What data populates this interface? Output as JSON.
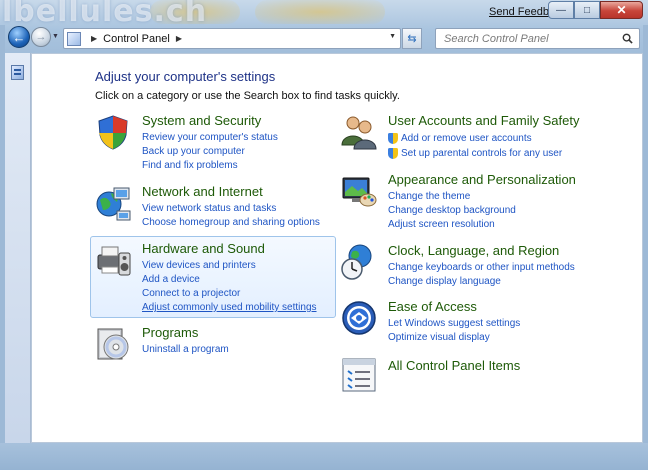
{
  "window": {
    "title_watermark": "lbellules.ch",
    "send_feedback": "Send Feedback"
  },
  "nav": {
    "address_text": "Control Panel",
    "search_placeholder": "Search Control Panel"
  },
  "main": {
    "heading": "Adjust your computer's settings",
    "subheading": "Click on a category or use the Search box to find tasks quickly."
  },
  "categories": [
    {
      "title": "System and Security",
      "icon": "shield-icon",
      "links": [
        "Review your computer's status",
        "Back up your computer",
        "Find and fix problems"
      ]
    },
    {
      "title": "Network and Internet",
      "icon": "network-globe-icon",
      "links": [
        "View network status and tasks",
        "Choose homegroup and sharing options"
      ]
    },
    {
      "title": "Hardware and Sound",
      "icon": "printer-speaker-icon",
      "links": [
        "View devices and printers",
        "Add a device",
        "Connect to a projector",
        "Adjust commonly used mobility settings"
      ]
    },
    {
      "title": "Programs",
      "icon": "programs-disc-icon",
      "links": [
        "Uninstall a program"
      ]
    },
    {
      "title": "User Accounts and Family Safety",
      "icon": "users-icon",
      "links": [
        "Add or remove user accounts",
        "Set up parental controls for any user"
      ]
    },
    {
      "title": "Appearance and Personalization",
      "icon": "monitor-palette-icon",
      "links": [
        "Change the theme",
        "Change desktop background",
        "Adjust screen resolution"
      ]
    },
    {
      "title": "Clock, Language, and Region",
      "icon": "clock-globe-icon",
      "links": [
        "Change keyboards or other input methods",
        "Change display language"
      ]
    },
    {
      "title": "Ease of Access",
      "icon": "ease-of-access-icon",
      "links": [
        "Let Windows suggest settings",
        "Optimize visual display"
      ]
    },
    {
      "title": "All Control Panel Items",
      "icon": "list-icon",
      "links": []
    }
  ]
}
